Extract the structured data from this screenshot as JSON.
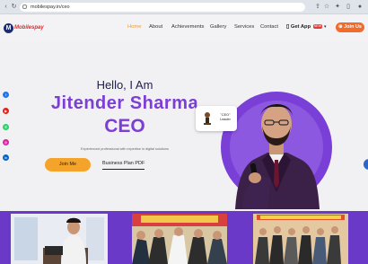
{
  "browser": {
    "url": "mobilespay.in/ceo",
    "tab_icons": [
      "back-icon",
      "forward-icon",
      "reload-icon",
      "lock-icon",
      "share-icon",
      "star-icon",
      "extensions-icon",
      "sidebar-icon"
    ]
  },
  "header": {
    "logo_mark": "M",
    "logo_text": "Mobilespay",
    "nav": [
      "Home",
      "About",
      "Achievements",
      "Gallery",
      "Services",
      "Contact"
    ],
    "active_nav": "Home",
    "get_app_label": "Get App",
    "new_badge": "NEW",
    "join_label": "Join Us"
  },
  "social": [
    "facebook-icon",
    "youtube-icon",
    "whatsapp-icon",
    "instagram-icon",
    "linkedin-icon"
  ],
  "hero": {
    "greeting": "Hello, I Am",
    "name": "Jitender Sharma",
    "role": "CEO",
    "tagline": "Experienced professional with expertise in digital solutions",
    "join_button": "Join Me",
    "plan_link": "Business Plan PDF",
    "badge_line1": "\"CEO\"",
    "badge_line2": "Leader"
  },
  "colors": {
    "accent_purple": "#7b3fd4",
    "accent_orange": "#f4a32b",
    "join_orange": "#f26b2a",
    "navy": "#1d2c6e"
  }
}
